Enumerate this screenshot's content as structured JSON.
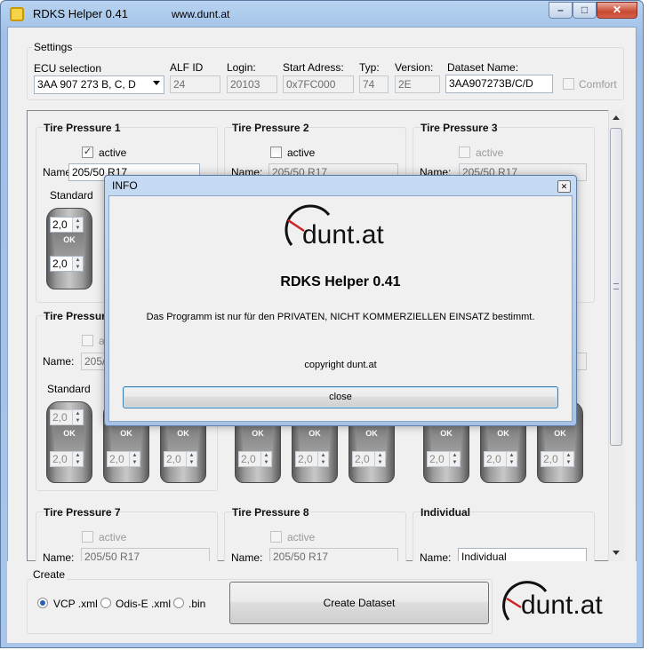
{
  "window": {
    "title": "RDKS Helper 0.41",
    "url": "www.dunt.at",
    "min_glyph": "–",
    "max_glyph": "□",
    "close_glyph": "✕"
  },
  "settings": {
    "group_label": "Settings",
    "ecu_label": "ECU selection",
    "ecu_value": "3AA 907 273 B, C, D",
    "alf_label": "ALF ID",
    "alf_value": "24",
    "login_label": "Login:",
    "login_value": "20103",
    "start_label": "Start Adress:",
    "start_value": "0x7FC000",
    "typ_label": "Typ:",
    "typ_value": "74",
    "version_label": "Version:",
    "version_value": "2E",
    "dataset_label": "Dataset Name:",
    "dataset_value": "3AA907273B/C/D",
    "comfort_label": "Comfort"
  },
  "cards": {
    "tp1": {
      "title": "Tire Pressure 1",
      "active_label": "active",
      "checked": "✓",
      "name_label": "Name:",
      "name_value": "205/50 R17",
      "standard_label": "Standard",
      "front": "2,0",
      "rear": "2,0",
      "ok": "OK"
    },
    "tp2": {
      "title": "Tire Pressure 2",
      "active_label": "active",
      "name_label": "Name:",
      "name_value": "205/50 R17"
    },
    "tp3": {
      "title": "Tire Pressure 3",
      "active_label": "active",
      "name_label": "Name:",
      "name_value": "205/50 R17"
    },
    "tp4": {
      "title": "Tire Pressure",
      "active_label": "ac",
      "name_label": "Name:",
      "name_value": "205/5",
      "standard_label": "Standard",
      "values": [
        "2,0",
        "2,0",
        "2,0"
      ],
      "ok": "OK"
    },
    "tp5": {
      "values": [
        "2,0",
        "2,0"
      ],
      "ok": "OK"
    },
    "tp6": {
      "values": [
        "2,0",
        "2,0"
      ],
      "ok": "OK"
    },
    "tp7": {
      "title": "Tire Pressure 7",
      "active_label": "active",
      "name_label": "Name:",
      "name_value": "205/50 R17"
    },
    "tp8": {
      "title": "Tire Pressure 8",
      "active_label": "active",
      "name_label": "Name:",
      "name_value": "205/50 R17"
    },
    "ind": {
      "title": "Individual",
      "name_label": "Name:",
      "name_value": "Individual"
    }
  },
  "dialog": {
    "title": "INFO",
    "close_glyph": "✕",
    "logo_text": "dunt.at",
    "heading": "RDKS Helper 0.41",
    "message": "Das Programm ist nur für den PRIVATEN, NICHT KOMMERZIELLEN EINSATZ bestimmt.",
    "copyright": "copyright dunt.at",
    "close_label": "close"
  },
  "create": {
    "group_label": "Create",
    "options": [
      "VCP .xml",
      "Odis-E .xml",
      ".bin"
    ],
    "selected": "VCP .xml",
    "button_label": "Create Dataset",
    "logo_text": "dunt.at"
  },
  "colors": {
    "accent": "#3399ff",
    "logo_needle": "#cc2222"
  }
}
